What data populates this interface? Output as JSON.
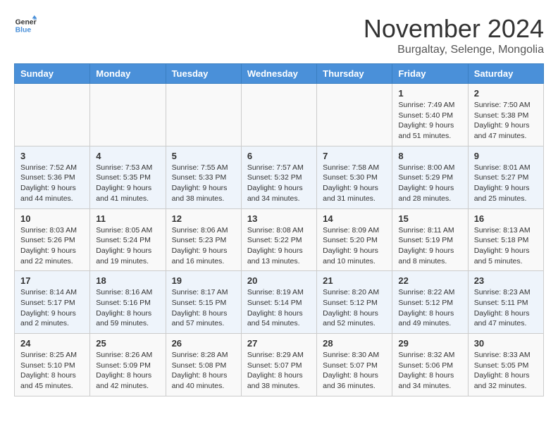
{
  "logo": {
    "line1": "General",
    "line2": "Blue"
  },
  "title": "November 2024",
  "subtitle": "Burgaltay, Selenge, Mongolia",
  "days_of_week": [
    "Sunday",
    "Monday",
    "Tuesday",
    "Wednesday",
    "Thursday",
    "Friday",
    "Saturday"
  ],
  "weeks": [
    [
      {
        "day": "",
        "info": ""
      },
      {
        "day": "",
        "info": ""
      },
      {
        "day": "",
        "info": ""
      },
      {
        "day": "",
        "info": ""
      },
      {
        "day": "",
        "info": ""
      },
      {
        "day": "1",
        "info": "Sunrise: 7:49 AM\nSunset: 5:40 PM\nDaylight: 9 hours and 51 minutes."
      },
      {
        "day": "2",
        "info": "Sunrise: 7:50 AM\nSunset: 5:38 PM\nDaylight: 9 hours and 47 minutes."
      }
    ],
    [
      {
        "day": "3",
        "info": "Sunrise: 7:52 AM\nSunset: 5:36 PM\nDaylight: 9 hours and 44 minutes."
      },
      {
        "day": "4",
        "info": "Sunrise: 7:53 AM\nSunset: 5:35 PM\nDaylight: 9 hours and 41 minutes."
      },
      {
        "day": "5",
        "info": "Sunrise: 7:55 AM\nSunset: 5:33 PM\nDaylight: 9 hours and 38 minutes."
      },
      {
        "day": "6",
        "info": "Sunrise: 7:57 AM\nSunset: 5:32 PM\nDaylight: 9 hours and 34 minutes."
      },
      {
        "day": "7",
        "info": "Sunrise: 7:58 AM\nSunset: 5:30 PM\nDaylight: 9 hours and 31 minutes."
      },
      {
        "day": "8",
        "info": "Sunrise: 8:00 AM\nSunset: 5:29 PM\nDaylight: 9 hours and 28 minutes."
      },
      {
        "day": "9",
        "info": "Sunrise: 8:01 AM\nSunset: 5:27 PM\nDaylight: 9 hours and 25 minutes."
      }
    ],
    [
      {
        "day": "10",
        "info": "Sunrise: 8:03 AM\nSunset: 5:26 PM\nDaylight: 9 hours and 22 minutes."
      },
      {
        "day": "11",
        "info": "Sunrise: 8:05 AM\nSunset: 5:24 PM\nDaylight: 9 hours and 19 minutes."
      },
      {
        "day": "12",
        "info": "Sunrise: 8:06 AM\nSunset: 5:23 PM\nDaylight: 9 hours and 16 minutes."
      },
      {
        "day": "13",
        "info": "Sunrise: 8:08 AM\nSunset: 5:22 PM\nDaylight: 9 hours and 13 minutes."
      },
      {
        "day": "14",
        "info": "Sunrise: 8:09 AM\nSunset: 5:20 PM\nDaylight: 9 hours and 10 minutes."
      },
      {
        "day": "15",
        "info": "Sunrise: 8:11 AM\nSunset: 5:19 PM\nDaylight: 9 hours and 8 minutes."
      },
      {
        "day": "16",
        "info": "Sunrise: 8:13 AM\nSunset: 5:18 PM\nDaylight: 9 hours and 5 minutes."
      }
    ],
    [
      {
        "day": "17",
        "info": "Sunrise: 8:14 AM\nSunset: 5:17 PM\nDaylight: 9 hours and 2 minutes."
      },
      {
        "day": "18",
        "info": "Sunrise: 8:16 AM\nSunset: 5:16 PM\nDaylight: 8 hours and 59 minutes."
      },
      {
        "day": "19",
        "info": "Sunrise: 8:17 AM\nSunset: 5:15 PM\nDaylight: 8 hours and 57 minutes."
      },
      {
        "day": "20",
        "info": "Sunrise: 8:19 AM\nSunset: 5:14 PM\nDaylight: 8 hours and 54 minutes."
      },
      {
        "day": "21",
        "info": "Sunrise: 8:20 AM\nSunset: 5:12 PM\nDaylight: 8 hours and 52 minutes."
      },
      {
        "day": "22",
        "info": "Sunrise: 8:22 AM\nSunset: 5:12 PM\nDaylight: 8 hours and 49 minutes."
      },
      {
        "day": "23",
        "info": "Sunrise: 8:23 AM\nSunset: 5:11 PM\nDaylight: 8 hours and 47 minutes."
      }
    ],
    [
      {
        "day": "24",
        "info": "Sunrise: 8:25 AM\nSunset: 5:10 PM\nDaylight: 8 hours and 45 minutes."
      },
      {
        "day": "25",
        "info": "Sunrise: 8:26 AM\nSunset: 5:09 PM\nDaylight: 8 hours and 42 minutes."
      },
      {
        "day": "26",
        "info": "Sunrise: 8:28 AM\nSunset: 5:08 PM\nDaylight: 8 hours and 40 minutes."
      },
      {
        "day": "27",
        "info": "Sunrise: 8:29 AM\nSunset: 5:07 PM\nDaylight: 8 hours and 38 minutes."
      },
      {
        "day": "28",
        "info": "Sunrise: 8:30 AM\nSunset: 5:07 PM\nDaylight: 8 hours and 36 minutes."
      },
      {
        "day": "29",
        "info": "Sunrise: 8:32 AM\nSunset: 5:06 PM\nDaylight: 8 hours and 34 minutes."
      },
      {
        "day": "30",
        "info": "Sunrise: 8:33 AM\nSunset: 5:05 PM\nDaylight: 8 hours and 32 minutes."
      }
    ]
  ]
}
